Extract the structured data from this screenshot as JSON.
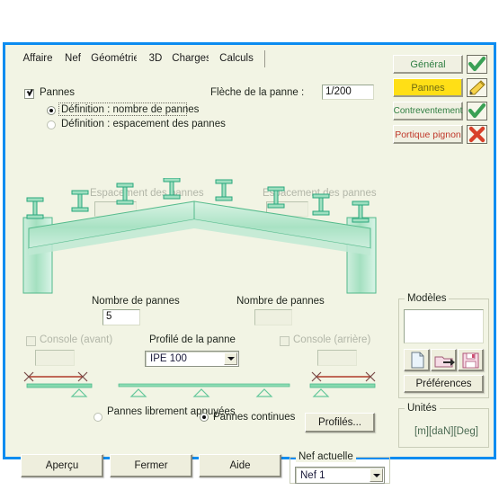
{
  "window": {
    "accent_color": "#0c8cf0",
    "background": "#f2f4e4"
  },
  "tabs": [
    {
      "label": "Affaire",
      "selected": false
    },
    {
      "label": "Nef",
      "selected": false
    },
    {
      "label": "Géométrie",
      "selected": false
    },
    {
      "label": "3D",
      "selected": true
    },
    {
      "label": "Charges",
      "selected": false
    },
    {
      "label": "Calculs",
      "selected": false
    }
  ],
  "main": {
    "pannes_checkbox": {
      "label": "Pannes",
      "checked": true
    },
    "fleche": {
      "label": "Flèche de la panne :",
      "value": "1/200"
    },
    "radios_definition": [
      {
        "label": "Définition : nombre de pannes",
        "selected": true,
        "focused": true
      },
      {
        "label": "Définition : espacement des pannes",
        "selected": false,
        "focused": false
      }
    ],
    "espacement_left": {
      "label": "Espacement des pannes",
      "value": "",
      "enabled": false
    },
    "espacement_right": {
      "label": "Espacement des pannes",
      "value": "",
      "enabled": false
    },
    "nombre_left": {
      "label": "Nombre de pannes",
      "value": "5"
    },
    "nombre_right": {
      "label": "Nombre de pannes",
      "value": ""
    },
    "console_avant": {
      "label": "Console (avant)",
      "checked": false,
      "enabled": false,
      "value": ""
    },
    "console_arriere": {
      "label": "Console (arrière)",
      "checked": false,
      "enabled": false,
      "value": ""
    },
    "profile_panne": {
      "label": "Profilé de la panne",
      "value": "IPE 100"
    },
    "radios_appui": [
      {
        "label": "Pannes librement appuyées",
        "selected": false
      },
      {
        "label": "Pannes continues",
        "selected": true
      }
    ],
    "profiles_button": "Profilés..."
  },
  "footer": {
    "apercu_button": "Aperçu",
    "fermer_button": "Fermer",
    "aide_button": "Aide",
    "nef_group_label": "Nef actuelle",
    "nef_value": "Nef 1"
  },
  "sidebar": {
    "actions": [
      {
        "label": "Général",
        "state": "ok",
        "icon": "green-check-icon",
        "highlighted": false
      },
      {
        "label": "Pannes",
        "state": "edit",
        "icon": "pencil-icon",
        "highlighted": true
      },
      {
        "label": "Contreventement",
        "state": "ok",
        "icon": "green-check-icon",
        "highlighted": false
      },
      {
        "label": "Portique pignon",
        "state": "error",
        "icon": "red-cross-icon",
        "highlighted": false
      }
    ],
    "modeles": {
      "label": "Modèles",
      "list_items": [],
      "tool_icons": [
        "new-document-icon",
        "open-folder-icon",
        "save-floppy-icon"
      ],
      "preferences_button": "Préférences"
    },
    "unites": {
      "label": "Unités",
      "value": "[m][daN][Deg]"
    }
  },
  "colors": {
    "ok_green": "#3aa055",
    "error_red": "#d8412a",
    "highlight_yellow": "#ffdf16",
    "steel_green": "#a8e0c2",
    "beam_red": "#c0392b"
  }
}
